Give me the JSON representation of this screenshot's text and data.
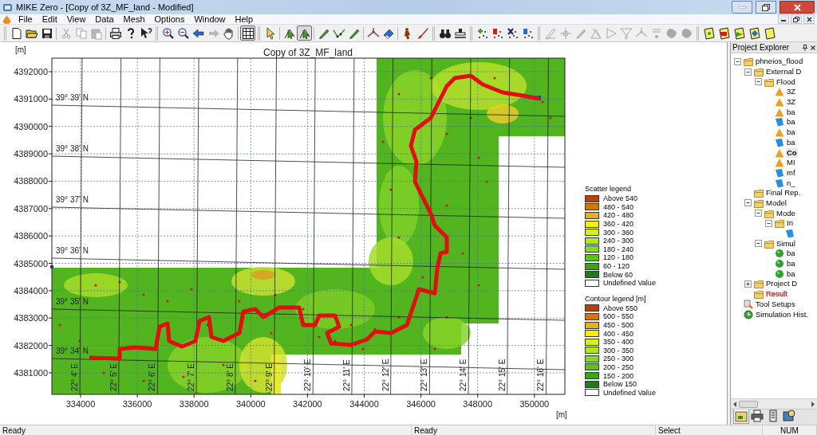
{
  "window": {
    "title": "MIKE Zero - [Copy of 3Z_MF_land - Modified]"
  },
  "menu": [
    "File",
    "Edit",
    "View",
    "Data",
    "Mesh",
    "Options",
    "Window",
    "Help"
  ],
  "toolbar": [
    [
      [
        {
          "kind": "new",
          "disabled": false,
          "pressed": false
        },
        {
          "kind": "open",
          "disabled": false,
          "pressed": false
        },
        {
          "kind": "save",
          "disabled": false,
          "pressed": false
        }
      ],
      [
        {
          "kind": "cut",
          "disabled": true,
          "pressed": false
        },
        {
          "kind": "copy",
          "disabled": true,
          "pressed": false
        },
        {
          "kind": "paste",
          "disabled": true,
          "pressed": false
        }
      ],
      [
        {
          "kind": "print",
          "disabled": false,
          "pressed": false
        },
        {
          "kind": "help",
          "disabled": false,
          "pressed": false
        },
        {
          "kind": "context-help",
          "disabled": false,
          "pressed": false
        }
      ]
    ],
    [
      [
        {
          "kind": "zoom-in",
          "disabled": false,
          "pressed": false
        },
        {
          "kind": "zoom-out",
          "disabled": false,
          "pressed": false
        },
        {
          "kind": "back",
          "disabled": false,
          "pressed": false
        },
        {
          "kind": "forward",
          "disabled": true,
          "pressed": false
        },
        {
          "kind": "pan",
          "disabled": false,
          "pressed": false
        }
      ],
      [
        {
          "kind": "grid",
          "disabled": false,
          "pressed": true
        }
      ]
    ],
    [
      [
        {
          "kind": "pointer",
          "disabled": false,
          "pressed": false
        }
      ],
      [
        {
          "kind": "vertex-pointer",
          "disabled": false,
          "pressed": false
        },
        {
          "kind": "vertex-pointer",
          "disabled": false,
          "pressed": true
        }
      ],
      [
        {
          "kind": "pen",
          "disabled": false,
          "pressed": false
        },
        {
          "kind": "polyline",
          "disabled": false,
          "pressed": false
        },
        {
          "kind": "pen",
          "disabled": false,
          "pressed": false
        }
      ],
      [
        {
          "kind": "split",
          "disabled": false,
          "pressed": false
        },
        {
          "kind": "eraser",
          "disabled": false,
          "pressed": false
        }
      ],
      [
        {
          "kind": "figure",
          "disabled": false,
          "pressed": false
        },
        {
          "kind": "brush",
          "disabled": false,
          "pressed": false
        }
      ]
    ],
    [
      [
        {
          "kind": "binoculars",
          "disabled": false,
          "pressed": false
        },
        {
          "kind": "stamp",
          "disabled": false,
          "pressed": false
        }
      ]
    ],
    [
      [
        {
          "kind": "dots-green",
          "disabled": false,
          "pressed": false
        },
        {
          "kind": "dots-red",
          "disabled": false,
          "pressed": false
        },
        {
          "kind": "dots-navy",
          "disabled": false,
          "pressed": false
        },
        {
          "kind": "dots-blue",
          "disabled": false,
          "pressed": false
        }
      ]
    ],
    [
      [
        {
          "kind": "pencil",
          "disabled": true,
          "pressed": false
        },
        {
          "kind": "cross",
          "disabled": true,
          "pressed": false
        },
        {
          "kind": "pen",
          "disabled": true,
          "pressed": false
        },
        {
          "kind": "triangle",
          "disabled": true,
          "pressed": false
        },
        {
          "kind": "play",
          "disabled": true,
          "pressed": false
        },
        {
          "kind": "funnel",
          "disabled": true,
          "pressed": false
        },
        {
          "kind": "split",
          "disabled": true,
          "pressed": false
        },
        {
          "kind": "edit-dot",
          "disabled": true,
          "pressed": false
        },
        {
          "kind": "blob",
          "disabled": true,
          "pressed": false
        },
        {
          "kind": "blob",
          "disabled": true,
          "pressed": false
        }
      ]
    ],
    [
      [
        {
          "kind": "page-yellow",
          "disabled": false,
          "pressed": false
        },
        {
          "kind": "page-red",
          "disabled": false,
          "pressed": false
        },
        {
          "kind": "page-green",
          "disabled": false,
          "pressed": false
        },
        {
          "kind": "page-blue",
          "disabled": false,
          "pressed": false
        },
        {
          "kind": "page-plain",
          "disabled": false,
          "pressed": false
        }
      ]
    ]
  ],
  "plot": {
    "title": "Copy of 3Z_MF_land",
    "y_unit": "[m]",
    "x_unit": "[m]",
    "y_ticks": [
      "4392000",
      "4391000",
      "4390000",
      "4389000",
      "4388000",
      "4387000",
      "4386000",
      "4385000",
      "4384000",
      "4383000",
      "4382000",
      "4381000"
    ],
    "x_ticks": [
      "334000",
      "336000",
      "338000",
      "340000",
      "342000",
      "344000",
      "346000",
      "348000",
      "350000"
    ],
    "lat_labels": [
      "39° 39' N",
      "39° 38' N",
      "39° 37' N",
      "39° 36' N",
      "39° 35' N",
      "39° 34' N"
    ],
    "lon_labels": [
      "22° 4' E",
      "22° 5' E",
      "22° 6' E",
      "22° 7' E",
      "22° 8' E",
      "22° 9' E",
      "22° 10' E",
      "22° 11' E",
      "22° 12' E",
      "22° 13' E",
      "22° 14' E",
      "22° 15' E",
      "22° 16' E"
    ]
  },
  "scatter_legend": {
    "title": "Scatter legend",
    "items": [
      {
        "label": "Above 540",
        "color": "#b8400c"
      },
      {
        "label": "480 - 540",
        "color": "#d0780e"
      },
      {
        "label": "420 - 480",
        "color": "#e2b21e"
      },
      {
        "label": "360 - 420",
        "color": "#f6f000"
      },
      {
        "label": "300 - 360",
        "color": "#d6f01e"
      },
      {
        "label": "240 - 300",
        "color": "#aaea1c"
      },
      {
        "label": "180 - 240",
        "color": "#80dc20"
      },
      {
        "label": "120 - 180",
        "color": "#58c41e"
      },
      {
        "label": "60 - 120",
        "color": "#38a41a"
      },
      {
        "label": "Below 60",
        "color": "#1a7e14"
      },
      {
        "label": "Undefined Value",
        "color": "#ffffff"
      }
    ]
  },
  "contour_legend": {
    "title": "Contour legend [m]",
    "items": [
      {
        "label": "Above 550",
        "color": "#b8400c"
      },
      {
        "label": "500 - 550",
        "color": "#d0780e"
      },
      {
        "label": "450 - 500",
        "color": "#e2b21e"
      },
      {
        "label": "400 - 450",
        "color": "#f6f000"
      },
      {
        "label": "350 - 400",
        "color": "#d6f01e"
      },
      {
        "label": "300 - 350",
        "color": "#aaea1c"
      },
      {
        "label": "250 - 300",
        "color": "#80dc20"
      },
      {
        "label": "200 - 250",
        "color": "#58c41e"
      },
      {
        "label": "150 - 200",
        "color": "#38a41a"
      },
      {
        "label": "Below 150",
        "color": "#1a7e14"
      },
      {
        "label": "Undefined Value",
        "color": "#ffffff"
      }
    ]
  },
  "project_explorer": {
    "title": "Project Explorer",
    "tree": [
      {
        "label": "phneios_flood",
        "kind": "folder",
        "expanded": true,
        "selected": false,
        "children": [
          {
            "label": "External D",
            "kind": "folder",
            "expanded": true,
            "selected": false,
            "children": [
              {
                "label": "Flood",
                "kind": "folder",
                "expanded": true,
                "selected": false,
                "children": [
                  {
                    "label": "3Z",
                    "kind": "triangle",
                    "selected": false
                  },
                  {
                    "label": "3Z",
                    "kind": "triangle",
                    "selected": false
                  },
                  {
                    "label": "ba",
                    "kind": "triangle",
                    "selected": false
                  },
                  {
                    "label": "ba",
                    "kind": "file",
                    "selected": false
                  },
                  {
                    "label": "ba",
                    "kind": "triangle",
                    "selected": false
                  },
                  {
                    "label": "ba",
                    "kind": "file",
                    "selected": false
                  },
                  {
                    "label": "Co",
                    "kind": "triangle",
                    "selected": true
                  },
                  {
                    "label": "MI",
                    "kind": "triangle",
                    "selected": false
                  },
                  {
                    "label": "mf",
                    "kind": "file",
                    "selected": false
                  },
                  {
                    "label": "n_",
                    "kind": "file",
                    "selected": false
                  }
                ]
              }
            ]
          },
          {
            "label": "Final Rep.",
            "kind": "folder",
            "selected": false
          },
          {
            "label": "Model",
            "kind": "folder",
            "expanded": true,
            "selected": false,
            "children": [
              {
                "label": "Mode",
                "kind": "folder",
                "expanded": true,
                "selected": false,
                "children": [
                  {
                    "label": "In",
                    "kind": "folder",
                    "expanded": true,
                    "selected": false,
                    "children": [
                      {
                        "kind": "file",
                        "selected": false
                      }
                    ]
                  }
                ]
              },
              {
                "label": "Simul",
                "kind": "folder",
                "expanded": true,
                "selected": false,
                "children": [
                  {
                    "label": "ba",
                    "kind": "circle",
                    "selected": false
                  },
                  {
                    "label": "ba",
                    "kind": "circle",
                    "selected": false
                  },
                  {
                    "label": "ba",
                    "kind": "circle",
                    "selected": false
                  }
                ]
              }
            ]
          },
          {
            "label": "Project D",
            "kind": "folder",
            "expanded": false,
            "selected": false
          },
          {
            "label": "Result",
            "kind": "folder",
            "selected": false,
            "color": "#c83232"
          }
        ]
      },
      {
        "label": "Tool Setups",
        "kind": "tool",
        "selected": false
      },
      {
        "label": "Simulation Hist.",
        "kind": "history",
        "selected": false
      }
    ],
    "tabs": [
      {
        "kind": "folder",
        "selected": true
      },
      {
        "kind": "printer",
        "selected": false
      },
      {
        "kind": "document",
        "selected": false
      },
      {
        "kind": "globe",
        "selected": false
      }
    ]
  },
  "status_bar": [
    "Ready",
    "Ready",
    "Select",
    "NUM"
  ]
}
